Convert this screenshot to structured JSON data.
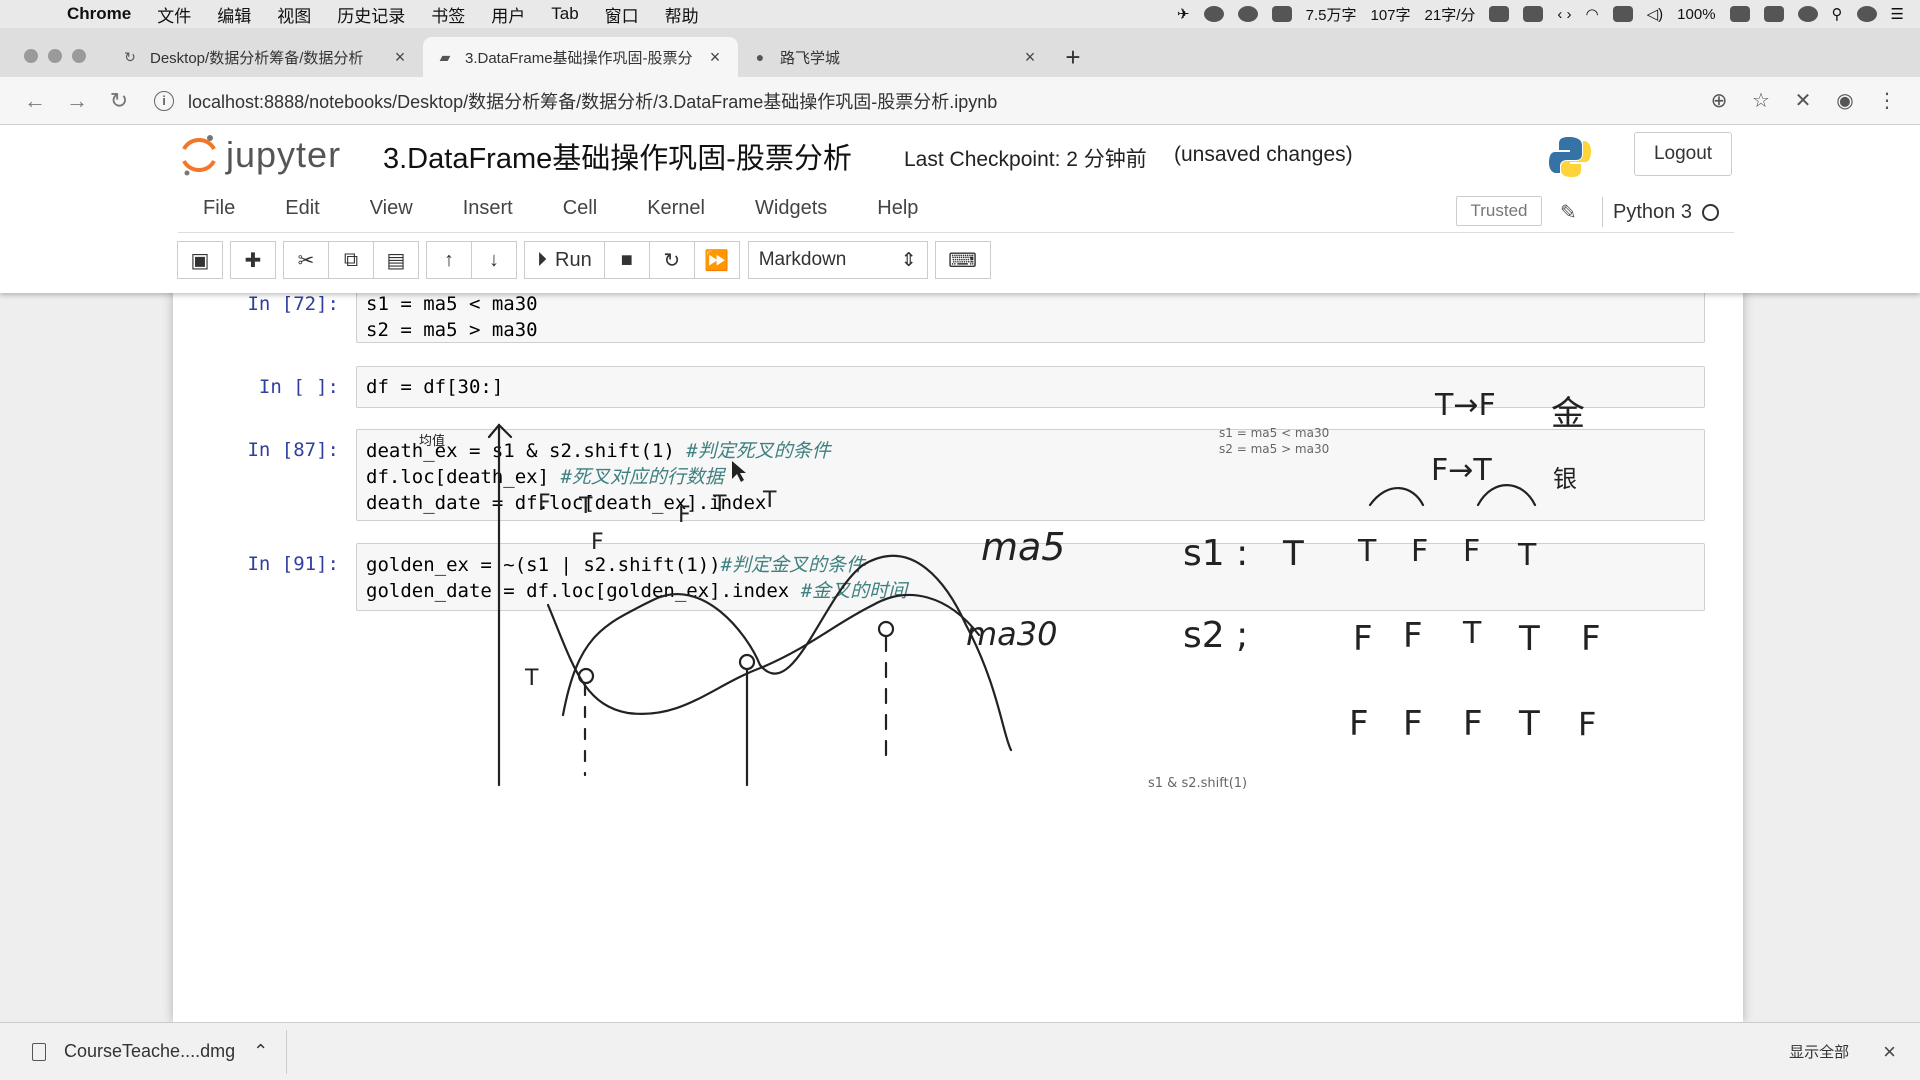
{
  "menubar": {
    "app": "Chrome",
    "items": [
      "文件",
      "编辑",
      "视图",
      "历史记录",
      "书签",
      "用户",
      "Tab",
      "窗口",
      "帮助"
    ],
    "status": {
      "words": "7.5万字",
      "chars": "107字",
      "speed": "21字/分",
      "battery": "100%"
    }
  },
  "tabs": [
    {
      "label": "Desktop/数据分析筹备/数据分析",
      "close": "×"
    },
    {
      "label": "3.DataFrame基础操作巩固-股票分",
      "close": "×"
    },
    {
      "label": "路飞学城",
      "close": "×"
    }
  ],
  "newtab": "+",
  "address": {
    "url": "localhost:8888/notebooks/Desktop/数据分析筹备/数据分析/3.DataFrame基础操作巩固-股票分析.ipynb"
  },
  "jupyter": {
    "logo": "jupyter",
    "title": "3.DataFrame基础操作巩固-股票分析",
    "checkpoint": "Last Checkpoint: 2 分钟前",
    "unsaved": "(unsaved changes)",
    "logout": "Logout",
    "menu": [
      "File",
      "Edit",
      "View",
      "Insert",
      "Cell",
      "Kernel",
      "Widgets",
      "Help"
    ],
    "trusted": "Trusted",
    "kernel": "Python 3",
    "run_label": "Run",
    "cell_type": "Markdown"
  },
  "cells": [
    {
      "prompt": "In [72]:",
      "lines": [
        "s1 = ma5 < ma30",
        "s2 = ma5 > ma30"
      ]
    },
    {
      "prompt": "In [ ]:",
      "lines": [
        "df = df[30:]"
      ]
    },
    {
      "prompt": "In [87]:",
      "lines": [
        "death_ex = s1 & s2.shift(1) ",
        "df.loc[death_ex] ",
        "death_date = df.loc[death_ex].index"
      ],
      "comments": [
        "#判定死叉的条件",
        "#死叉对应的行数据",
        ""
      ]
    },
    {
      "prompt": "In [91]:",
      "lines": [
        "golden_ex = ~(s1 | s2.shift(1))",
        "golden_date = df.loc[golden_ex].index "
      ],
      "comments": [
        "#判定金叉的条件",
        "#金叉的时间"
      ]
    }
  ],
  "drawing": {
    "axis_label": "均值",
    "note1": "s1 = ma5 < ma30",
    "note2": "s2 = ma5 > ma30",
    "note3": "s1 & s2.shift(1)",
    "ma5": "ma5",
    "ma30": "ma30",
    "tf_top": "T→F",
    "ft_top": "F→T",
    "gold": "金",
    "silver": "银",
    "s1_row": [
      "s1 :",
      "T",
      "T",
      "F",
      "F",
      "T"
    ],
    "s2_row": [
      "s2 ;",
      "F",
      "F",
      "T",
      "T",
      "F"
    ],
    "and_row": [
      "F",
      "F",
      "F",
      "T",
      "F"
    ],
    "curve_marks": [
      "T",
      "F",
      "F",
      "T",
      "T",
      "F",
      "T"
    ]
  },
  "download": {
    "file": "CourseTeache....dmg",
    "show_all": "显示全部",
    "close": "×"
  }
}
